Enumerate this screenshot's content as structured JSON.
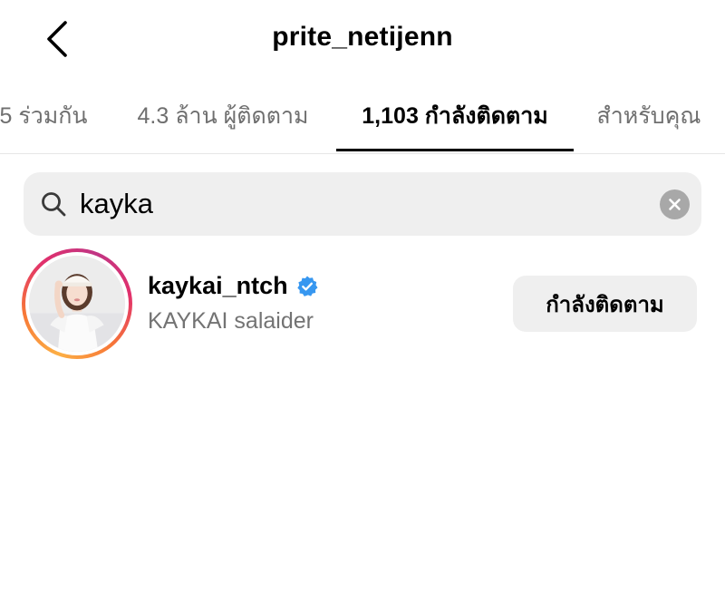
{
  "header": {
    "title": "prite_netijenn"
  },
  "tabs": [
    {
      "label": "5 ร่วมกัน"
    },
    {
      "label": "4.3 ล้าน ผู้ติดตาม"
    },
    {
      "label": "1,103 กำลังติดตาม"
    },
    {
      "label": "สำหรับคุณ"
    }
  ],
  "search": {
    "value": "kayka"
  },
  "result": {
    "username": "kaykai_ntch",
    "full_name": "KAYKAI salaider",
    "verified": true,
    "follow_button_label": "กำลังติดตาม"
  },
  "colors": {
    "verified_blue": "#3797f0",
    "search_bg": "#efefef",
    "secondary_text": "#737373"
  },
  "icons": [
    "back-arrow-icon",
    "search-icon",
    "clear-icon",
    "verified-badge-icon"
  ]
}
